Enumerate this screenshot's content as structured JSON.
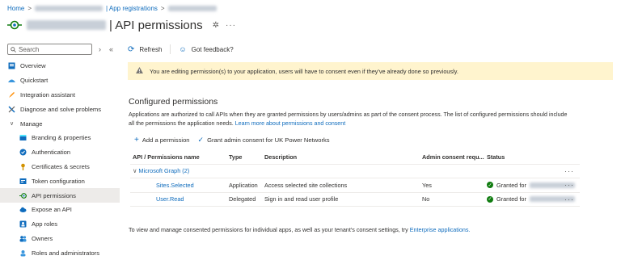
{
  "breadcrumb": {
    "home": "Home",
    "sep": ">",
    "app_registrations": "| App registrations"
  },
  "header": {
    "title": "| API permissions",
    "pin": "✲",
    "more": "···"
  },
  "sidebar": {
    "search_placeholder": "Search",
    "items": [
      {
        "label": "Overview",
        "icon": "overview-icon",
        "color": "#0f6cbd"
      },
      {
        "label": "Quickstart",
        "icon": "quickstart-icon",
        "color": "#3a96dd"
      },
      {
        "label": "Integration assistant",
        "icon": "rocket-icon",
        "color": "#ff8c00"
      },
      {
        "label": "Diagnose and solve problems",
        "icon": "wrench-icon",
        "color": "#323130"
      },
      {
        "label": "Manage",
        "icon": "chevron-down-icon"
      },
      {
        "label": "Branding & properties",
        "icon": "branding-icon",
        "color": "#0f6cbd"
      },
      {
        "label": "Authentication",
        "icon": "authentication-icon",
        "color": "#0f6cbd"
      },
      {
        "label": "Certificates & secrets",
        "icon": "key-icon",
        "color": "#d29200"
      },
      {
        "label": "Token configuration",
        "icon": "token-icon",
        "color": "#0f6cbd"
      },
      {
        "label": "API permissions",
        "icon": "api-permissions-icon",
        "color": "#107c10"
      },
      {
        "label": "Expose an API",
        "icon": "cloud-icon",
        "color": "#0f6cbd"
      },
      {
        "label": "App roles",
        "icon": "app-roles-icon",
        "color": "#0f6cbd"
      },
      {
        "label": "Owners",
        "icon": "owners-icon",
        "color": "#0f6cbd"
      },
      {
        "label": "Roles and administrators",
        "icon": "roles-icon",
        "color": "#3a96dd"
      }
    ]
  },
  "toolbar": {
    "refresh": "Refresh",
    "feedback": "Got feedback?"
  },
  "warning": "You are editing permission(s) to your application, users will have to consent even if they've already done so previously.",
  "configured": {
    "title": "Configured permissions",
    "desc_1": "Applications are authorized to call APIs when they are granted permissions by users/admins as part of the consent process. The list of configured permissions should include",
    "desc_2": "all the permissions the application needs.",
    "desc_link": "Learn more about permissions and consent",
    "add_permission": "Add a permission",
    "grant_consent": "Grant admin consent for UK Power Networks"
  },
  "table": {
    "headers": [
      "API / Permissions name",
      "Type",
      "Description",
      "Admin consent requ...",
      "Status"
    ],
    "group": "Microsoft Graph (2)",
    "rows": [
      {
        "name": "Sites.Selected",
        "type": "Application",
        "description": "Access selected site collections",
        "admin": "Yes",
        "status": "Granted for"
      },
      {
        "name": "User.Read",
        "type": "Delegated",
        "description": "Sign in and read user profile",
        "admin": "No",
        "status": "Granted for"
      }
    ],
    "more": "···"
  },
  "footer": {
    "text": "To view and manage consented permissions for individual apps, as well as your tenant's consent settings, try",
    "link": "Enterprise applications."
  }
}
